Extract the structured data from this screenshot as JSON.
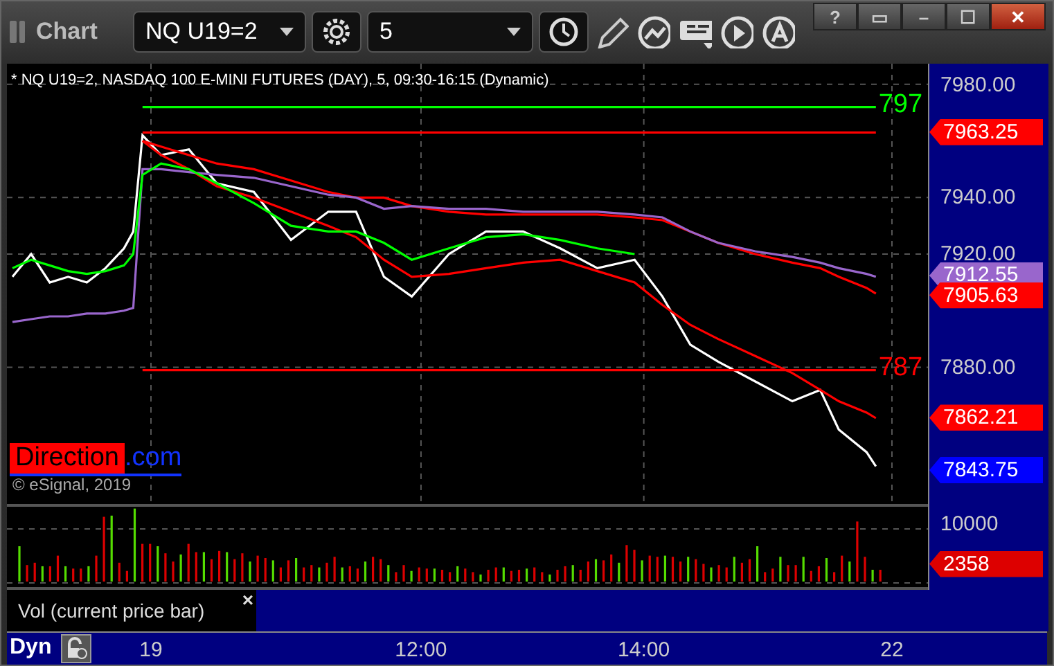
{
  "window": {
    "title": "Chart",
    "controls": [
      "?",
      "▭",
      "–",
      "☐",
      "✕"
    ]
  },
  "toolbar": {
    "symbol": "NQ U19=2",
    "interval": "5"
  },
  "price_pane": {
    "header": "* NQ U19=2, NASDAQ 100 E-MINI FUTURES (DAY), 5, 09:30-16:15 (Dynamic)",
    "chart_data": {
      "type": "line",
      "x": [
        8.333,
        8.5,
        8.667,
        8.833,
        9,
        9.167,
        9.333,
        9.417,
        9.5,
        9.667,
        9.917,
        10.167,
        10.5,
        10.833,
        11.167,
        11.417,
        11.667,
        11.917,
        12.25,
        12.583,
        12.917,
        13.25,
        13.583,
        13.917,
        14.167,
        14.417,
        14.667,
        15,
        15.333,
        15.583,
        15.75,
        16,
        16.083
      ],
      "series": [
        {
          "color": "#ffffff",
          "values": [
            7912,
            7920,
            7910,
            7912,
            7910,
            7915,
            7922,
            7928,
            7962,
            7955,
            7957,
            7945,
            7942,
            7925,
            7935,
            7935,
            7912,
            7905,
            7920,
            7928,
            7928,
            7922,
            7915,
            7918,
            7905,
            7888,
            7882,
            7875,
            7868,
            7872,
            7858,
            7850,
            7845
          ]
        },
        {
          "color": "#ff0000",
          "values": [
            null,
            null,
            null,
            null,
            null,
            null,
            null,
            null,
            7960,
            7955,
            7950,
            7944,
            7940,
            7935,
            7930,
            7926,
            7918,
            7912,
            7913,
            7915,
            7917,
            7918,
            7914,
            7910,
            7902,
            7895,
            7890,
            7884,
            7878,
            7872,
            7868,
            7864,
            7862
          ]
        },
        {
          "color": "#ff0000",
          "values": [
            null,
            null,
            null,
            null,
            null,
            null,
            null,
            null,
            7960,
            7958,
            7955,
            7952,
            7950,
            7946,
            7942,
            7940,
            7940,
            7937,
            7935,
            7934,
            7934,
            7934,
            7934,
            7933,
            7932,
            7928,
            7924,
            7920,
            7917,
            7915,
            7912,
            7908,
            7906
          ]
        },
        {
          "color": "#9966cc",
          "values": [
            7896,
            7897,
            7898,
            7898,
            7899,
            7899,
            7900,
            7901,
            7950,
            7950,
            7949,
            7948,
            7947,
            7944,
            7941,
            7940,
            7936,
            7937,
            7936,
            7936,
            7935,
            7935,
            7935,
            7934,
            7933,
            7928,
            7924,
            7921,
            7919,
            7917,
            7915,
            7913,
            7912
          ]
        },
        {
          "color": "#00ff00",
          "values": [
            7915,
            7918,
            7916,
            7914,
            7913,
            7914,
            7916,
            7920,
            7948,
            7952,
            7950,
            7945,
            7938,
            7930,
            7928,
            7928,
            7924,
            7918,
            7922,
            7926,
            7927,
            7925,
            7922,
            7920,
            null,
            null,
            null,
            null,
            null,
            null,
            null,
            null,
            null
          ]
        },
        {
          "color": "#00ff00",
          "values": [
            null,
            null,
            null,
            null,
            null,
            null,
            null,
            null,
            7972,
            7972,
            7972,
            7972,
            7972,
            7972,
            7972,
            7972,
            7972,
            7972,
            7972,
            7972,
            7972,
            7972,
            7972,
            7972,
            7972,
            7972,
            7972,
            7972,
            7972,
            7972,
            7972,
            7972,
            7972
          ]
        },
        {
          "color": "#ff0000",
          "values": [
            null,
            null,
            null,
            null,
            null,
            null,
            null,
            null,
            7963,
            7963,
            7963,
            7963,
            7963,
            7963,
            7963,
            7963,
            7963,
            7963,
            7963,
            7963,
            7963,
            7963,
            7963,
            7963,
            7963,
            7963,
            7963,
            7963,
            7963,
            7963,
            7963,
            7963,
            7963
          ]
        },
        {
          "color": "#ff0000",
          "values": [
            null,
            null,
            null,
            null,
            null,
            null,
            null,
            null,
            7879,
            7879,
            7879,
            7879,
            7879,
            7879,
            7879,
            7879,
            7879,
            7879,
            7879,
            7879,
            7879,
            7879,
            7879,
            7879,
            7879,
            7879,
            7879,
            7879,
            7879,
            7879,
            7879,
            7879,
            7879
          ]
        }
      ],
      "xlim": [
        8.283,
        17.62
      ],
      "grid": true,
      "xticks": [
        {
          "value": 12,
          "label": "12:00"
        },
        {
          "value": 14,
          "label": "14:00"
        }
      ],
      "ylim": [
        7801,
        7987.3
      ],
      "yticks": [
        {
          "value": 7980,
          "label": "7980.00"
        },
        {
          "value": 7940,
          "label": "7940.00"
        },
        {
          "value": 7920,
          "label": "7920.00"
        },
        {
          "value": 7880,
          "label": "7880.00"
        }
      ],
      "annotations": [
        "797",
        "787"
      ]
    },
    "price_tags": [
      {
        "text": "7963.25",
        "color": "#ff0000"
      },
      {
        "text": "7912.55",
        "color": "#9966cc"
      },
      {
        "text": "7905.63",
        "color": "#ff0000"
      },
      {
        "text": "7862.21",
        "color": "#ff0000"
      },
      {
        "text": "7843.75",
        "color": "#0000ff"
      }
    ],
    "logo": {
      "name": "Direction",
      "suffix": ".com"
    },
    "copyright": "© eSignal, 2019"
  },
  "volume_pane": {
    "tick": "10000",
    "tag": {
      "text": "2358",
      "color": "#dd0000"
    },
    "label": "Vol (current price bar)",
    "close": "×"
  },
  "time_axis": {
    "mode": "Dyn",
    "date_labels": [
      "19",
      "22"
    ]
  }
}
